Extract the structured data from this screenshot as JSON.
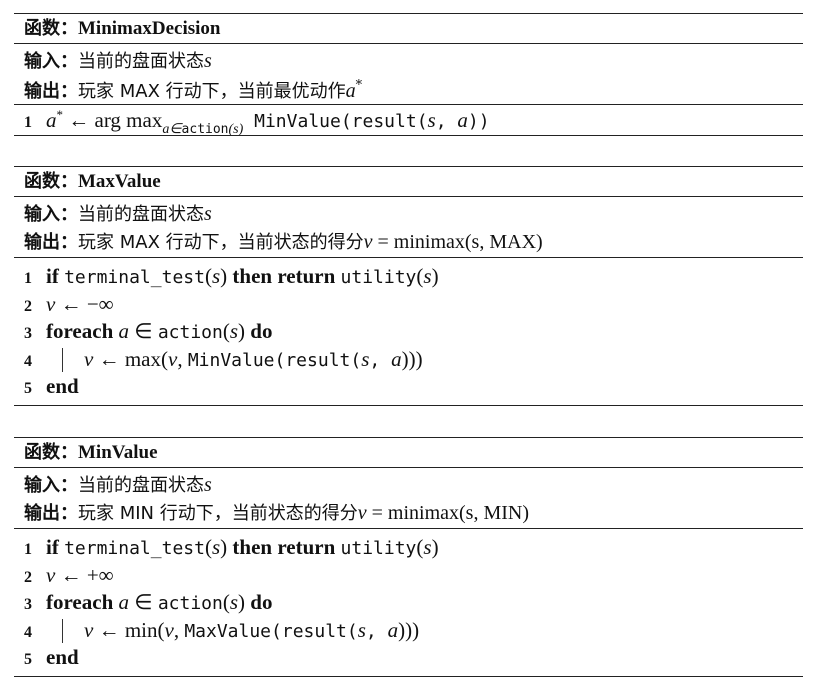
{
  "algorithms": [
    {
      "kw": "函数：",
      "name": "MinimaxDecision",
      "input_kw": "输入：",
      "input_text": "当前的盘面状态",
      "input_var": "s",
      "output_kw": "输出：",
      "output_text": "玩家 MAX 行动下，当前最优动作",
      "output_var": "a",
      "output_sup": "*",
      "lines": [
        {
          "num": "1",
          "a": "a",
          "sup": "*",
          "arrow": " ← arg max",
          "sub1": "a∈",
          "sub2": "action",
          "sub3": "(s)",
          "call": " MinValue(result(",
          "s": "s",
          "comma": ", ",
          "a2": "a",
          "close": "))"
        }
      ]
    },
    {
      "kw": "函数：",
      "name": "MaxValue",
      "input_kw": "输入：",
      "input_text": "当前的盘面状态",
      "input_var": "s",
      "output_kw": "输出：",
      "output_text": "玩家 MAX 行动下，当前状态的得分",
      "output_var": "v",
      "output_eq": " = minimax(s, MAX)",
      "lines": [
        {
          "num": "1",
          "if": "if ",
          "test": "terminal_test",
          "p1": "(",
          "s": "s",
          "p2": ") ",
          "then": "then return ",
          "util": "utility",
          "p3": "(",
          "s2": "s",
          "p4": ")"
        },
        {
          "num": "2",
          "v": "v",
          "rest": " ← −∞"
        },
        {
          "num": "3",
          "foreach": "foreach ",
          "a": "a",
          "in": " ∈ ",
          "act": "action",
          "p1": "(",
          "s": "s",
          "p2": ") ",
          "do": "do"
        },
        {
          "num": "4",
          "v": "v",
          "op": " ← max(",
          "v2": "v",
          "comma": ", ",
          "call": "MinValue(result(",
          "s": "s",
          "comma2": ", ",
          "a": "a",
          "close": ")))"
        },
        {
          "num": "5",
          "end": "end"
        }
      ]
    },
    {
      "kw": "函数：",
      "name": "MinValue",
      "input_kw": "输入：",
      "input_text": "当前的盘面状态",
      "input_var": "s",
      "output_kw": "输出：",
      "output_text": "玩家 MIN 行动下，当前状态的得分",
      "output_var": "v",
      "output_eq": " = minimax(s, MIN)",
      "lines": [
        {
          "num": "1",
          "if": "if ",
          "test": "terminal_test",
          "p1": "(",
          "s": "s",
          "p2": ") ",
          "then": "then return ",
          "util": "utility",
          "p3": "(",
          "s2": "s",
          "p4": ")"
        },
        {
          "num": "2",
          "v": "v",
          "rest": " ← +∞"
        },
        {
          "num": "3",
          "foreach": "foreach ",
          "a": "a",
          "in": " ∈ ",
          "act": "action",
          "p1": "(",
          "s": "s",
          "p2": ") ",
          "do": "do"
        },
        {
          "num": "4",
          "v": "v",
          "op": " ← min(",
          "v2": "v",
          "comma": ", ",
          "call": "MaxValue(result(",
          "s": "s",
          "comma2": ", ",
          "a": "a",
          "close": ")))"
        },
        {
          "num": "5",
          "end": "end"
        }
      ]
    }
  ]
}
